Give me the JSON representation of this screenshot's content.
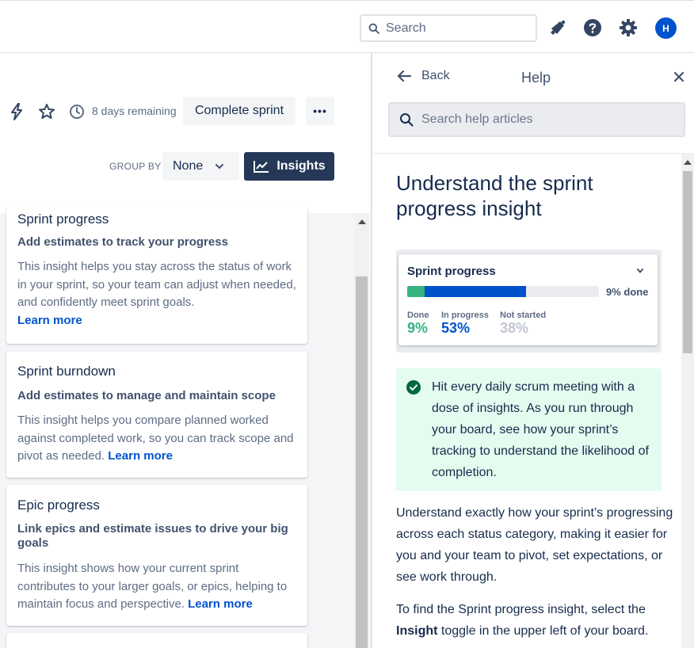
{
  "topbar": {
    "search_placeholder": "Search",
    "notifications_icon": "megaphone-icon",
    "help_icon": "help-icon",
    "settings_icon": "gear-icon",
    "avatar_initial": "H"
  },
  "board": {
    "remaining": "8 days remaining",
    "complete_sprint": "Complete sprint",
    "more": "•••",
    "group_by_label": "GROUP BY",
    "group_by_value": "None",
    "insights_button": "Insights"
  },
  "insight_cards": [
    {
      "title": "Sprint progress",
      "subtitle": "Add estimates to track your progress",
      "body": "This insight helps you stay across the status of work in your sprint, so your team can adjust when needed, and confidently meet sprint goals.",
      "link": "Learn more"
    },
    {
      "title": "Sprint burndown",
      "subtitle": "Add estimates to manage and maintain scope",
      "body": "This insight helps you compare planned worked against completed work, so you can track scope and pivot as needed.",
      "link": "Learn more"
    },
    {
      "title": "Epic progress",
      "subtitle": "Link epics and estimate issues to drive your big goals",
      "body": "This insight shows how your current sprint contributes to your larger goals, or epics, helping to maintain focus and perspective.",
      "link": "Learn more"
    }
  ],
  "help": {
    "back": "Back",
    "title": "Help",
    "search_placeholder": "Search help articles",
    "article_title": "Understand the sprint progress insight",
    "preview": {
      "title": "Sprint progress",
      "percent_done_label": "9% done",
      "done_fraction": 0.09,
      "in_progress_fraction": 0.53,
      "done_label": "Done",
      "done_value": "9%",
      "in_progress_label": "In progress",
      "in_progress_value": "53%",
      "not_started_label": "Not started",
      "not_started_value": "38%",
      "colors": {
        "done": "#36b37e",
        "in_progress": "#0052cc",
        "not_started": "#c1c7d0"
      }
    },
    "tip": "Hit every daily scrum meeting with a dose of insights. As you run through your board, see how your sprint’s tracking to understand the likelihood of completion.",
    "paragraph1": "Understand exactly how your sprint’s progressing across each status category, making it easier for you and your team to pivot, set expectations, or see work through.",
    "paragraph2_before": "To find the Sprint progress insight, select the ",
    "paragraph2_bold": "Insight",
    "paragraph2_after": " toggle in the upper left of your board."
  }
}
